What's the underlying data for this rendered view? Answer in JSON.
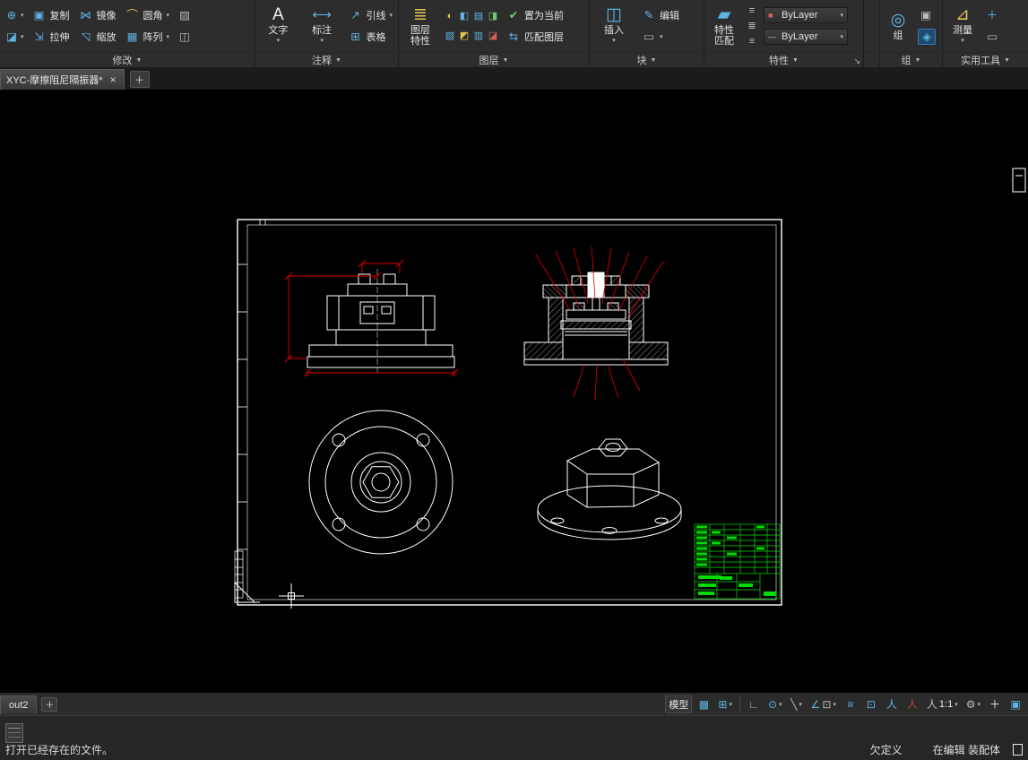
{
  "ribbon": {
    "modify": {
      "panel": "修改",
      "copy": "复制",
      "mirror": "镜像",
      "fillet": "圆角",
      "stretch": "拉伸",
      "scale": "缩放",
      "array": "阵列"
    },
    "annotate": {
      "panel": "注释",
      "text": "文字",
      "dimension": "标注",
      "leader": "引线",
      "table": "表格"
    },
    "layers": {
      "panel": "图层",
      "props1": "图层",
      "props2": "特性",
      "set_current": "置为当前",
      "match_layer": "匹配图层"
    },
    "block": {
      "panel": "块",
      "insert": "插入",
      "edit": "编辑"
    },
    "properties": {
      "panel": "特性",
      "match1": "特性",
      "match2": "匹配",
      "color_value": "ByLayer",
      "linetype_value": "ByLayer"
    },
    "group": {
      "panel": "组",
      "group": "组"
    },
    "utilities": {
      "panel": "实用工具",
      "measure": "测量"
    }
  },
  "file_tabs": {
    "active": "XYC-摩擦阻尼隔振器*"
  },
  "layout_tabs": {
    "active": "out2"
  },
  "status_bar": {
    "model": "模型",
    "scale": "1:1"
  },
  "command": {
    "history": "打开已经存在的文件。",
    "constraint": "欠定义",
    "editing": "在编辑 装配体"
  },
  "colors": {
    "dimension": "#e00000",
    "title_block": "#00dc00",
    "drawing_line": "#ffffff",
    "accent": "#4aa3e0"
  },
  "icons": {
    "caret": "▾",
    "caret_label": "▼",
    "close": "×",
    "plus": "＋",
    "expander": "↘",
    "move": "⊕",
    "trim": "◪",
    "copy": "▣",
    "mirror": "⋈",
    "fillet": "⌒",
    "stretch": "⇲",
    "scale": "◹",
    "array": "▦",
    "extra1": "▨",
    "extra2": "◫",
    "text": "A",
    "dimension": "⟷",
    "leader": "↗",
    "table": "⊞",
    "layer_props": "≣",
    "layer1": "◐",
    "layer2": "◧",
    "layer3": "▤",
    "layer4": "◨",
    "layer5": "▧",
    "layer6": "◩",
    "layer7": "▥",
    "layer8": "◪",
    "set_current": "✔",
    "match_layer": "⇆",
    "insert": "◫",
    "edit": "✎",
    "block_extra": "▭",
    "match_props": "▰",
    "prop1": "≡",
    "prop2": "≣",
    "prop3": "≡",
    "swatch": "■",
    "line_swatch": "—",
    "group": "◎",
    "group1": "▣",
    "group2": "◈",
    "measure": "⊿",
    "util1": "＋",
    "util2": "▭",
    "grid": "▦",
    "snap": "⊞",
    "ortho": "∟",
    "polar": "⊙",
    "iso": "╲",
    "osnap": "∠",
    "lwt": "≡",
    "select": "⊡",
    "person": "人",
    "gear": "⚙",
    "monitor": "▣"
  }
}
